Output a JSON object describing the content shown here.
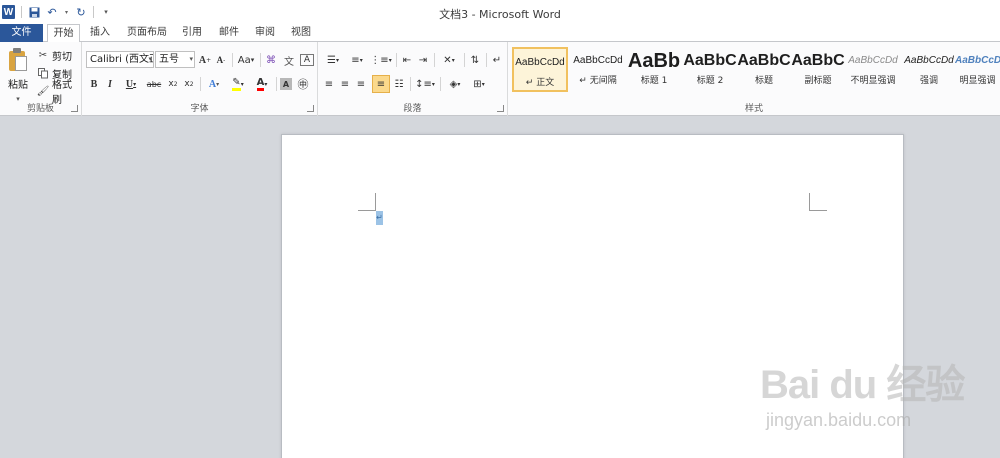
{
  "window": {
    "title": "文档3 - Microsoft Word"
  },
  "qat": {
    "app_icon": "W",
    "items": [
      "save-icon",
      "undo-icon",
      "redo-icon",
      "customize-icon"
    ]
  },
  "tabs": [
    "文件",
    "开始",
    "插入",
    "页面布局",
    "引用",
    "邮件",
    "审阅",
    "视图"
  ],
  "active_tab": "开始",
  "clipboard": {
    "paste": "粘贴",
    "cut": "剪切",
    "copy": "复制",
    "format_painter": "格式刷",
    "group": "剪贴板"
  },
  "font": {
    "family": "Calibri (西文正",
    "size": "五号",
    "group": "字体",
    "buttons": [
      "A+",
      "A-",
      "Aa",
      "clear-format",
      "phonetic",
      "border-char",
      "B",
      "I",
      "U",
      "abc",
      "x₂",
      "x²",
      "text-effect",
      "highlight",
      "font-color",
      "char-shading",
      "enclose-char"
    ]
  },
  "paragraph": {
    "group": "段落"
  },
  "styles": {
    "group": "样式",
    "items": [
      {
        "sample": "AaBbCcDd",
        "name": "↵ 正文",
        "selected": true
      },
      {
        "sample": "AaBbCcDd",
        "name": "↵ 无间隔"
      },
      {
        "sample": "AaBb",
        "name": "标题 1"
      },
      {
        "sample": "AaBbC",
        "name": "标题 2"
      },
      {
        "sample": "AaBbC",
        "name": "标题"
      },
      {
        "sample": "AaBbC",
        "name": "副标题"
      },
      {
        "sample": "AaBbCcDd",
        "name": "不明显强调"
      },
      {
        "sample": "AaBbCcDd",
        "name": "强调"
      },
      {
        "sample": "AaBbCcDd",
        "name": "明显强调"
      }
    ]
  },
  "document": {
    "paragraph_mark": "↵"
  },
  "watermark": {
    "main": "Bai du 经验",
    "sub": "jingyan.baidu.com"
  },
  "colors": {
    "file_tab": "#2b579a",
    "selected_style": "#f1c15f",
    "highlight": "#ffff00",
    "font_color": "#ff0000"
  }
}
